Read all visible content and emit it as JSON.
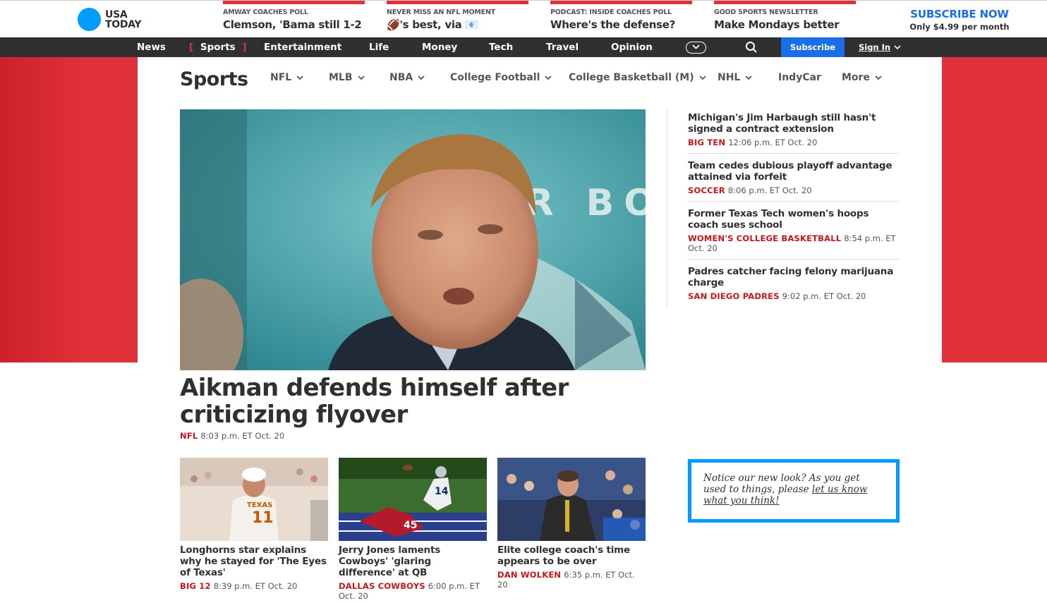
{
  "brand": {
    "logo_line1": "USA",
    "logo_line2": "TODAY"
  },
  "promos": [
    {
      "kicker": "AMWAY COACHES POLL",
      "headline": "Clemson, 'Bama still 1-2"
    },
    {
      "kicker": "NEVER MISS AN NFL MOMENT",
      "headline": "🏈's best, via 📧"
    },
    {
      "kicker": "PODCAST: INSIDE COACHES POLL",
      "headline": "Where's the defense?"
    },
    {
      "kicker": "GOOD SPORTS NEWSLETTER",
      "headline": "Make Mondays better"
    }
  ],
  "subscribe_cta": {
    "title": "SUBSCRIBE NOW",
    "price": "Only $4.99 per month"
  },
  "nav": {
    "items": [
      "News",
      "Sports",
      "Entertainment",
      "Life",
      "Money",
      "Tech",
      "Travel",
      "Opinion"
    ],
    "active_open": "[",
    "active_close": "]",
    "subscribe_label": "Subscribe",
    "signin_label": "Sign In"
  },
  "section": {
    "title": "Sports",
    "subnav": [
      "NFL",
      "MLB",
      "NBA",
      "College Football",
      "College Basketball (M)",
      "NHL",
      "IndyCar",
      "More"
    ]
  },
  "hero": {
    "headline": "Aikman defends himself after criticizing flyover",
    "tag": "NFL",
    "time": "8:03 p.m. ET Oct. 20",
    "backdrop_text": "ER BO"
  },
  "rail": [
    {
      "title": "Michigan's Jim Harbaugh still hasn't signed a contract extension",
      "tag": "BIG TEN",
      "time": "12:06 p.m. ET Oct. 20"
    },
    {
      "title": "Team cedes dubious playoff advantage attained via forfeit",
      "tag": "SOCCER",
      "time": "8:06 p.m. ET Oct. 20"
    },
    {
      "title": "Former Texas Tech women's hoops coach sues school",
      "tag": "WOMEN'S COLLEGE BASKETBALL",
      "time": "8:54 p.m. ET Oct. 20"
    },
    {
      "title": "Padres catcher facing felony marijuana charge",
      "tag": "SAN DIEGO PADRES",
      "time": "9:02 p.m. ET Oct. 20"
    }
  ],
  "cards": [
    {
      "title": "Longhorns star explains why he stayed for 'The Eyes of Texas'",
      "tag": "BIG 12",
      "time": "8:39 p.m. ET Oct. 20",
      "jersey_text": "TEXAS",
      "jersey_number": "11"
    },
    {
      "title": "Jerry Jones laments Cowboys' 'glaring difference' at QB",
      "tag": "DALLAS COWBOYS",
      "time": "6:00 p.m. ET Oct. 20",
      "jersey_number": "14",
      "jersey_number_2": "45"
    },
    {
      "title": "Elite college coach's time appears to be over",
      "tag": "DAN WOLKEN",
      "time": "6:35 p.m. ET Oct. 20"
    }
  ],
  "feedback": {
    "text_before": "Notice our new look? As you get used to things, please ",
    "link_text": "let us know what you think!"
  },
  "colors": {
    "accent_red": "#e0303a",
    "brand_blue": "#009bff",
    "subscribe_blue": "#1a6ee8",
    "nav_bg": "#303030",
    "tag_red": "#c4161c"
  }
}
